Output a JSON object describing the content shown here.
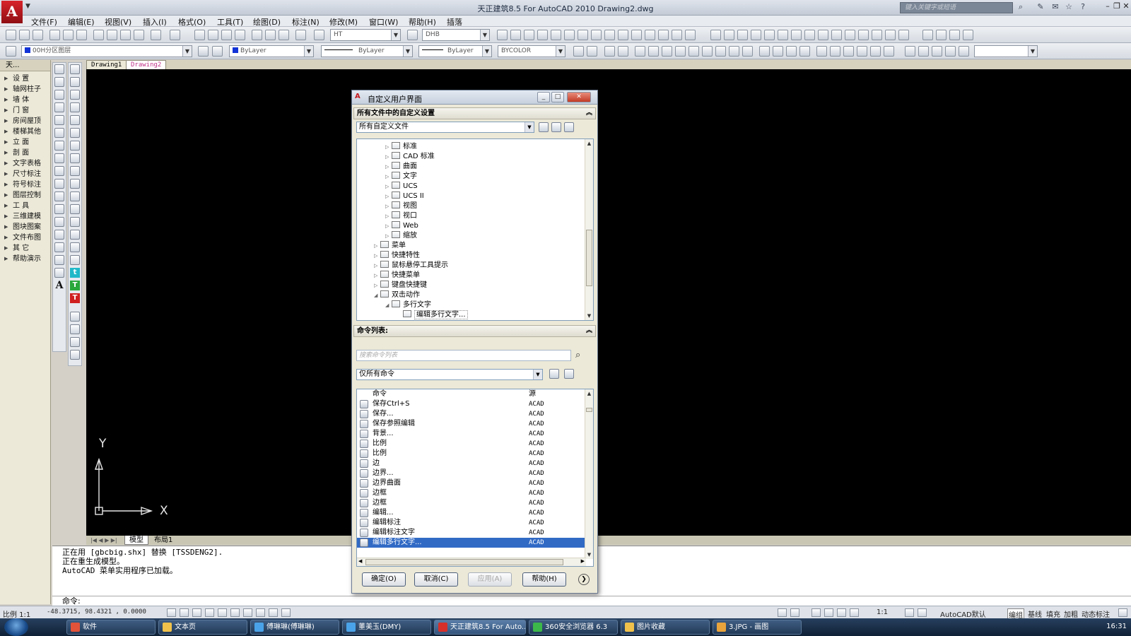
{
  "window": {
    "title": "天正建筑8.5 For AutoCAD 2010    Drawing2.dwg",
    "app_logo": "A",
    "search_placeholder": "键入关键字或短语"
  },
  "menu": [
    "文件(F)",
    "编辑(E)",
    "视图(V)",
    "插入(I)",
    "格式(O)",
    "工具(T)",
    "绘图(D)",
    "标注(N)",
    "修改(M)",
    "窗口(W)",
    "帮助(H)",
    "插落"
  ],
  "toolbar": {
    "text_style": "HT",
    "dim_style": "DHB",
    "layer": "00H分区图层",
    "color": "ByLayer",
    "linetype": "ByLayer",
    "lineweight": "ByLayer",
    "plotstyle": "BYCOLOR"
  },
  "tz_panel": {
    "title": "天...",
    "items": [
      "设    置",
      "轴网柱子",
      "墙    体",
      "门    窗",
      "房间屋顶",
      "楼梯其他",
      "立    面",
      "剖    面",
      "文字表格",
      "尺寸标注",
      "符号标注",
      "图层控制",
      "工    具",
      "三维建模",
      "图块图案",
      "文件布图",
      "其    它",
      "帮助演示"
    ]
  },
  "drawing_tabs": [
    "Drawing1",
    "Drawing2"
  ],
  "ucs": {
    "y": "Y",
    "x": "X"
  },
  "layout_tabs": [
    "模型",
    "布局1"
  ],
  "command_lines": [
    "正在用 [gbcbig.shx] 替换 [TSSDENG2].",
    "正在重生成模型。",
    "AutoCAD 菜单实用程序已加载。"
  ],
  "command_prompt": "命令:",
  "statusbar": {
    "scale": "比例 1:1",
    "coords": "-48.3715, 98.4321 , 0.0000",
    "annotation_scale": "1:1",
    "workspace": "AutoCAD默认",
    "toggles": [
      "编组",
      "基线",
      "填充",
      "加粗",
      "动态标注"
    ]
  },
  "taskbar": {
    "buttons": [
      {
        "label": "软件",
        "color": "#e2533a"
      },
      {
        "label": "文本页",
        "color": "#f0c24b"
      },
      {
        "label": "傅琳琳(傅琳琳)",
        "color": "#4aa3e8"
      },
      {
        "label": "董美玉(DMY)",
        "color": "#4aa3e8"
      },
      {
        "label": "天正建筑8.5 For Auto...",
        "color": "#d7302a"
      },
      {
        "label": "360安全浏览器 6.3",
        "color": "#3cb84a"
      },
      {
        "label": "图片收藏",
        "color": "#f0c24b"
      },
      {
        "label": "3.JPG - 画图",
        "color": "#e8a33c"
      }
    ],
    "clock": "16:31"
  },
  "dialog": {
    "title": "自定义用户界面",
    "section1_title": "所有文件中的自定义设置",
    "customize_file": "所有自定义文件",
    "tree": [
      {
        "label": "标准",
        "indent": 3
      },
      {
        "label": "CAD 标准",
        "indent": 3
      },
      {
        "label": "曲面",
        "indent": 3
      },
      {
        "label": "文字",
        "indent": 3
      },
      {
        "label": "UCS",
        "indent": 3
      },
      {
        "label": "UCS II",
        "indent": 3
      },
      {
        "label": "视图",
        "indent": 3
      },
      {
        "label": "视口",
        "indent": 3
      },
      {
        "label": "Web",
        "indent": 3
      },
      {
        "label": "缩放",
        "indent": 3
      },
      {
        "label": "菜单",
        "indent": 2
      },
      {
        "label": "快捷特性",
        "indent": 2
      },
      {
        "label": "鼠标悬停工具提示",
        "indent": 2
      },
      {
        "label": "快捷菜单",
        "indent": 2
      },
      {
        "label": "键盘快捷键",
        "indent": 2
      },
      {
        "label": "双击动作",
        "indent": 2
      },
      {
        "label": "多行文字",
        "indent": 3
      },
      {
        "label": "编辑多行文字...",
        "indent": 4
      }
    ],
    "section2_title": "命令列表:",
    "search_placeholder": "搜索命令列表",
    "filter": "仅所有命令",
    "columns": {
      "command": "命令",
      "source": "源"
    },
    "commands": [
      {
        "name": "保存Ctrl+S",
        "source": "ACAD"
      },
      {
        "name": "保存...",
        "source": "ACAD"
      },
      {
        "name": "保存参照编辑",
        "source": "ACAD"
      },
      {
        "name": "背景...",
        "source": "ACAD"
      },
      {
        "name": "比例",
        "source": "ACAD"
      },
      {
        "name": "比例",
        "source": "ACAD"
      },
      {
        "name": "边",
        "source": "ACAD"
      },
      {
        "name": "边界...",
        "source": "ACAD"
      },
      {
        "name": "边界曲面",
        "source": "ACAD"
      },
      {
        "name": "边框",
        "source": "ACAD"
      },
      {
        "name": "边框",
        "source": "ACAD"
      },
      {
        "name": "编辑...",
        "source": "ACAD"
      },
      {
        "name": "编辑标注",
        "source": "ACAD"
      },
      {
        "name": "编辑标注文字",
        "source": "ACAD"
      },
      {
        "name": "编辑多行文字...",
        "source": "ACAD"
      }
    ],
    "buttons": {
      "ok": "确定(O)",
      "cancel": "取消(C)",
      "apply": "应用(A)",
      "help": "帮助(H)"
    }
  }
}
